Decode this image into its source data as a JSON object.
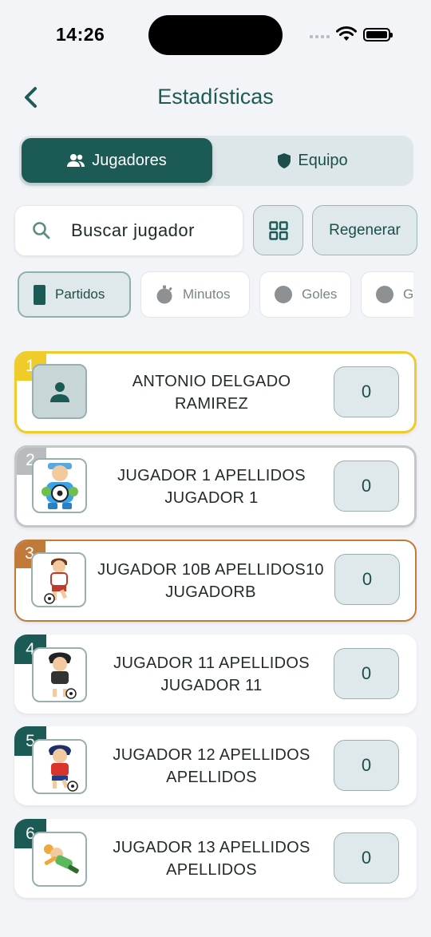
{
  "status_bar": {
    "time": "14:26"
  },
  "header": {
    "title": "Estadísticas"
  },
  "tabs": [
    {
      "label": "Jugadores",
      "icon": "people-icon",
      "active": true
    },
    {
      "label": "Equipo",
      "icon": "shield-icon",
      "active": false
    }
  ],
  "search": {
    "placeholder": "Buscar jugador"
  },
  "actions": {
    "regenerate_label": "Regenerar",
    "grid_icon": "grid-icon"
  },
  "filters": [
    {
      "label": "Partidos",
      "icon": "card-icon",
      "active": true
    },
    {
      "label": "Minutos",
      "icon": "stopwatch-icon",
      "active": false
    },
    {
      "label": "Goles",
      "icon": "ball-icon",
      "active": false
    },
    {
      "label": "G",
      "icon": "ball-icon",
      "active": false
    }
  ],
  "colors": {
    "primary": "#1c5a56",
    "gold": "#f0cc2a",
    "silver": "#b8bcbf",
    "bronze": "#c27a3a",
    "rank_default": "#1c5a56"
  },
  "players": [
    {
      "rank": "1",
      "name": "ANTONIO DELGADO RAMIREZ",
      "value": "0",
      "avatar": "placeholder-person-icon"
    },
    {
      "rank": "2",
      "name": "JUGADOR 1 APELLIDOS JUGADOR 1",
      "value": "0",
      "avatar": "goalkeeper-avatar"
    },
    {
      "rank": "3",
      "name": "JUGADOR 10B APELLIDOS10 JUGADORB",
      "value": "0",
      "avatar": "soccer-player-avatar"
    },
    {
      "rank": "4",
      "name": "JUGADOR 11 APELLIDOS JUGADOR 11",
      "value": "0",
      "avatar": "soccer-player-avatar"
    },
    {
      "rank": "5",
      "name": "JUGADOR 12 APELLIDOS APELLIDOS",
      "value": "0",
      "avatar": "soccer-player-avatar"
    },
    {
      "rank": "6",
      "name": "JUGADOR 13 APELLIDOS APELLIDOS",
      "value": "0",
      "avatar": "goalkeeper-diving-avatar"
    }
  ]
}
